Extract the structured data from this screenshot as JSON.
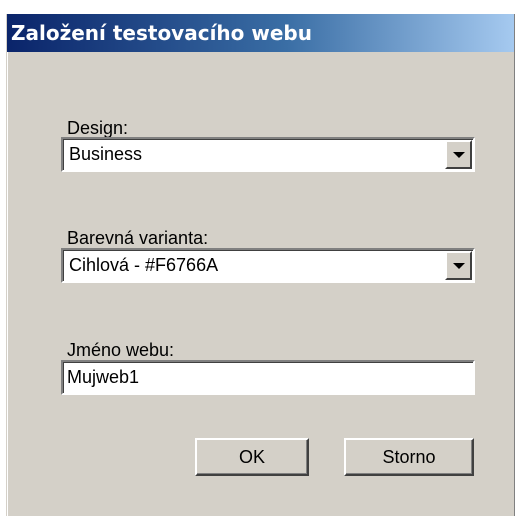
{
  "dialog": {
    "title": "Založení testovacího webu"
  },
  "fields": {
    "design": {
      "label": "Design:",
      "value": "Business"
    },
    "color_variant": {
      "label": "Barevná varianta:",
      "value": "Cihlová - #F6766A"
    },
    "site_name": {
      "label": "Jméno webu:",
      "value": "Mujweb1"
    }
  },
  "buttons": {
    "ok_label": "OK",
    "cancel_label": "Storno"
  },
  "colors": {
    "dialog_background": "#d4d0c8",
    "titlebar_start": "#0a246a",
    "titlebar_end": "#a6caf0"
  }
}
